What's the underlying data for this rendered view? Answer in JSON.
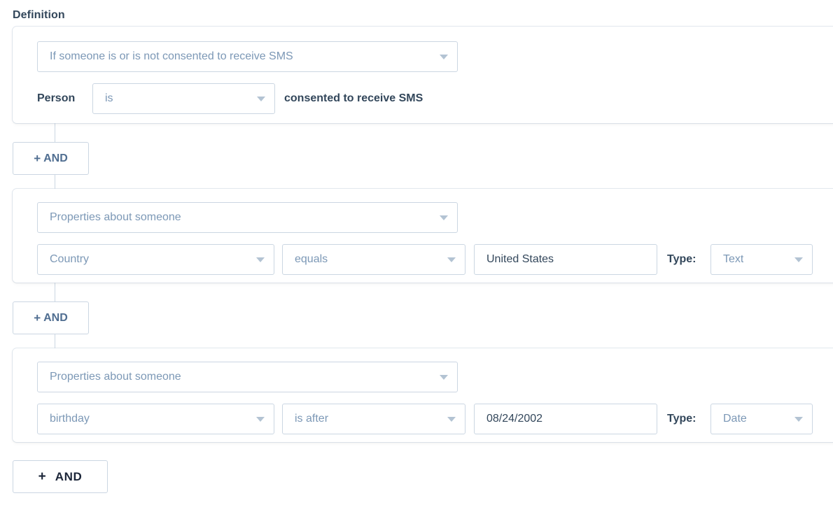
{
  "heading": "Definition",
  "filter_groups": [
    {
      "type_select": {
        "value": "If someone is or is not consented to receive SMS",
        "icon": "chevron-down-icon"
      },
      "prefix_label": "Person",
      "operator_select": {
        "value": "is",
        "icon": "chevron-down-icon"
      },
      "suffix_label": "consented to receive SMS"
    },
    {
      "type_select": {
        "value": "Properties about someone",
        "icon": "chevron-down-icon"
      },
      "property_select": {
        "value": "Country",
        "icon": "chevron-down-icon"
      },
      "operator_select": {
        "value": "equals",
        "icon": "chevron-down-icon"
      },
      "value_input": {
        "value": "United States"
      },
      "type_label": "Type:",
      "value_type_select": {
        "value": "Text",
        "icon": "chevron-down-icon"
      }
    },
    {
      "type_select": {
        "value": "Properties about someone",
        "icon": "chevron-down-icon"
      },
      "property_select": {
        "value": "birthday",
        "icon": "chevron-down-icon"
      },
      "operator_select": {
        "value": "is after",
        "icon": "chevron-down-icon"
      },
      "value_input": {
        "value": "08/24/2002"
      },
      "type_label": "Type:",
      "value_type_select": {
        "value": "Date",
        "icon": "chevron-down-icon"
      }
    }
  ],
  "and_buttons": {
    "inline_1": {
      "plus": "+",
      "label": "AND"
    },
    "inline_2": {
      "plus": "+",
      "label": "AND"
    },
    "bottom": {
      "plus": "+",
      "label": "AND"
    }
  },
  "colors": {
    "text_dark": "#33475b",
    "text_muted": "#7c98b6",
    "border": "#cbd6e2",
    "caret": "#b3c3d3",
    "and_text": "#506e91",
    "background": "#ffffff"
  }
}
